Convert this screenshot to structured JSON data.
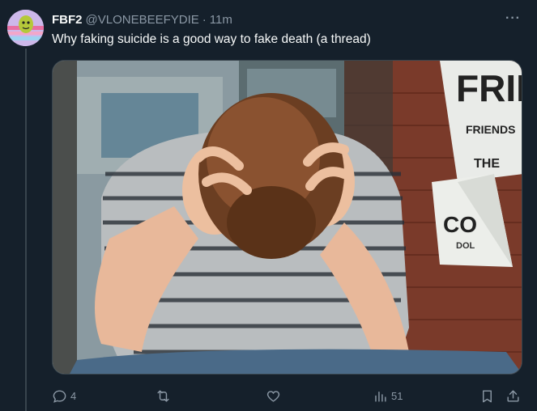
{
  "tweet": {
    "author_name": "FBF2",
    "handle": "@VLONEBEEFYDIE",
    "separator": "·",
    "time": "11m",
    "more": "···",
    "text": "Why faking suicide is a good way to fake death (a thread)"
  },
  "media": {
    "poster_lines": [
      "FRIE",
      "FRIENDS",
      "THE",
      "CO",
      "DOL"
    ]
  },
  "actions": {
    "replies": "4",
    "retweets": "",
    "likes": "",
    "views": "51"
  }
}
